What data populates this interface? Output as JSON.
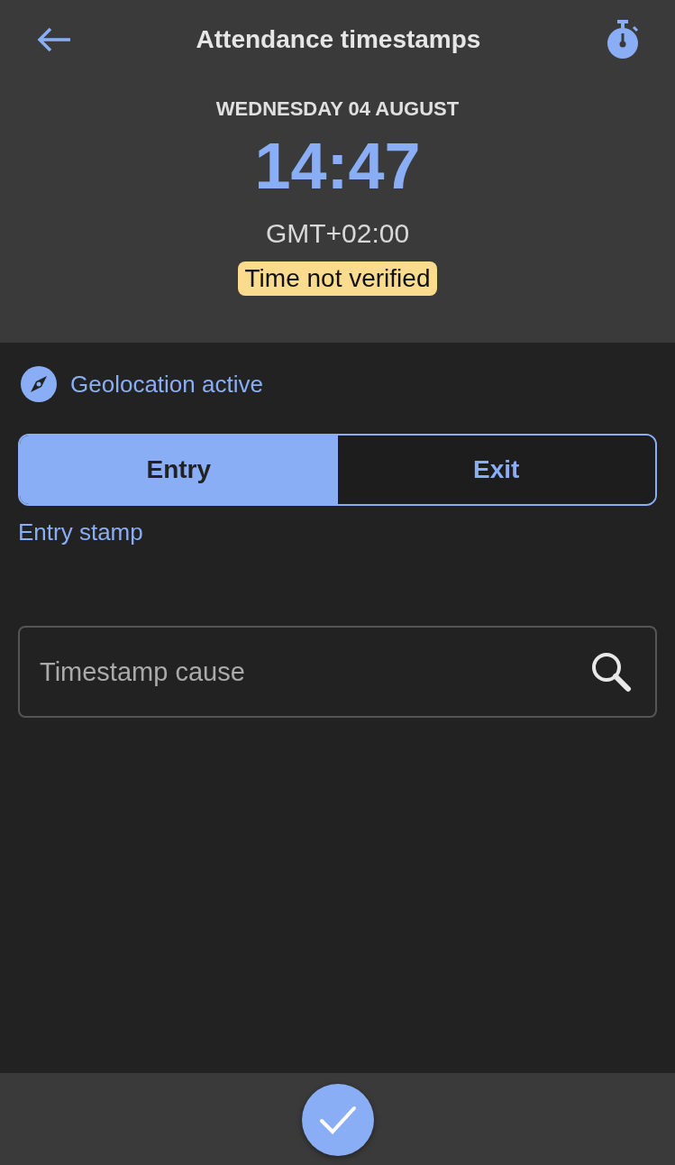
{
  "header": {
    "title": "Attendance timestamps",
    "date": "WEDNESDAY 04 AUGUST",
    "time": "14:47",
    "timezone": "GMT+02:00",
    "badge": "Time not verified"
  },
  "geolocation": {
    "label": "Geolocation active"
  },
  "tabs": [
    {
      "label": "Entry",
      "selected": true
    },
    {
      "label": "Exit",
      "selected": false
    }
  ],
  "stamp_label": "Entry stamp",
  "cause_field": {
    "placeholder": "Timestamp cause"
  }
}
